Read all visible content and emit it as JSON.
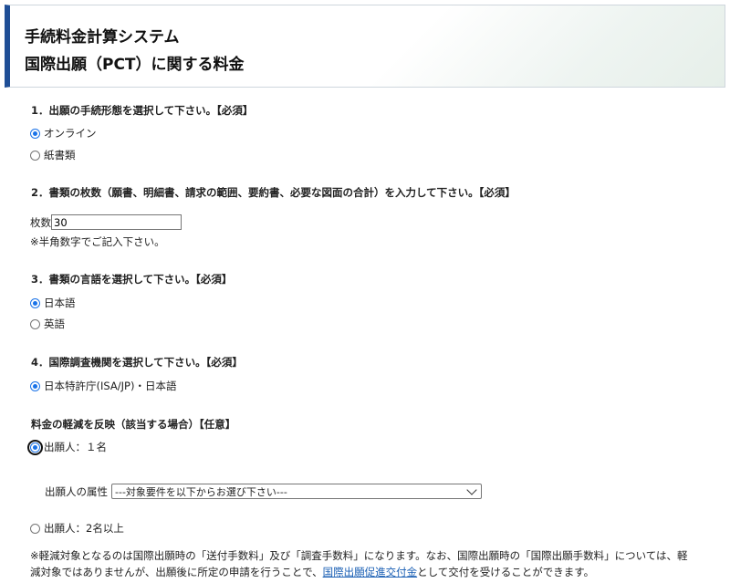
{
  "header": {
    "title_line1": "手続料金計算システム",
    "title_line2": "国際出願（PCT）に関する料金"
  },
  "q1": {
    "label": "1．出願の手続形態を選択して下さい。【必須】",
    "options": [
      {
        "label": "オンライン",
        "selected": true
      },
      {
        "label": "紙書類",
        "selected": false
      }
    ]
  },
  "q2": {
    "label": "2．書類の枚数（願書、明細書、請求の範囲、要約書、必要な図面の合計）を入力して下さい。【必須】",
    "field_label": "枚数",
    "value": "30",
    "hint": "※半角数字でご記入下さい。"
  },
  "q3": {
    "label": "3．書類の言語を選択して下さい。【必須】",
    "options": [
      {
        "label": "日本語",
        "selected": true
      },
      {
        "label": "英語",
        "selected": false
      }
    ]
  },
  "q4": {
    "label": "4．国際調査機関を選択して下さい。【必須】",
    "options": [
      {
        "label": "日本特許庁(ISA/JP)・日本語",
        "selected": true
      }
    ]
  },
  "reduction": {
    "label": "料金の軽減を反映（該当する場合）【任意】",
    "option1": {
      "label": "出願人：１名",
      "selected": true
    },
    "attr_label": "出願人の属性",
    "select_value": "---対象要件を以下からお選び下さい---",
    "option2": {
      "label": "出願人：2名以上",
      "selected": false
    }
  },
  "footnote": {
    "line1": "※軽減対象となるのは国際出願時の「送付手数料」及び「調査手数料」になります。なお、国際出願時の「国際出願手数料」については、軽",
    "line2_pre": "減対象ではありませんが、出願後に所定の申請を行うことで、",
    "link": "国際出願促進交付金",
    "line2_post": "として交付を受けることができます。"
  },
  "colors": {
    "accent": "#1f4e96",
    "radio": "#1a73e8",
    "link": "#1a5fb4"
  }
}
